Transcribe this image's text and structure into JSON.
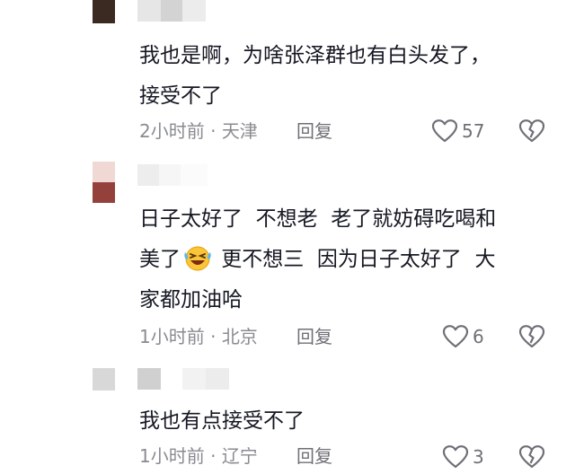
{
  "comments": [
    {
      "text": "我也是啊，为啥张泽群也有白头发了，\n接受不了",
      "time": "2小时前",
      "separator": "·",
      "location": "天津",
      "reply_label": "回复",
      "like_count": "57"
    },
    {
      "text_part1": "日子太好了  不想老  老了就妨碍吃喝和\n美了",
      "emoji": "laughing-crying-emoji",
      "text_part2": " 更不想三  因为日子太好了  大\n家都加油哈",
      "time": "1小时前",
      "separator": "·",
      "location": "北京",
      "reply_label": "回复",
      "like_count": "6"
    },
    {
      "text": "我也有点接受不了",
      "time": "1小时前",
      "separator": "·",
      "location": "辽宁",
      "reply_label": "回复",
      "like_count": "3"
    }
  ],
  "colors": {
    "text": "#161823",
    "meta": "#8a8b91",
    "icon": "#6f7077"
  }
}
